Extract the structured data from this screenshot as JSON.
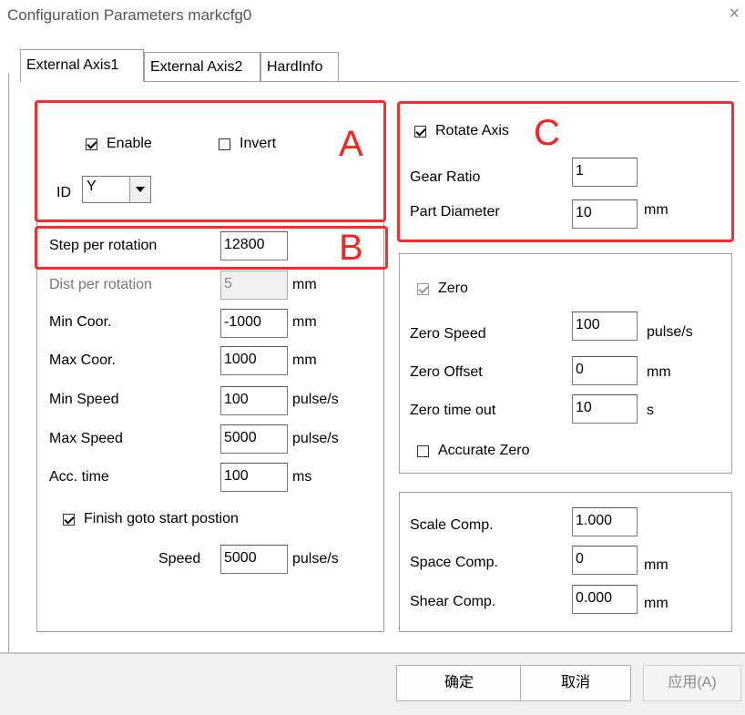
{
  "window": {
    "title": "Configuration Parameters markcfg0",
    "close_glyph": "×"
  },
  "tabs": [
    "External Axis1",
    "External Axis2",
    "HardInfo"
  ],
  "group_a": {
    "enable_label": "Enable",
    "enable_checked": true,
    "invert_label": "Invert",
    "invert_checked": false,
    "id_label": "ID",
    "id_value": "Y",
    "marker": "A"
  },
  "axis_params": {
    "step_label": "Step per rotation",
    "step_value": "12800",
    "dist_label": "Dist per rotation",
    "dist_value": "5",
    "dist_unit": "mm",
    "min_coor_label": "Min Coor.",
    "min_coor_value": "-1000",
    "min_coor_unit": "mm",
    "max_coor_label": "Max Coor.",
    "max_coor_value": "1000",
    "max_coor_unit": "mm",
    "min_speed_label": "Min Speed",
    "min_speed_value": "100",
    "min_speed_unit": "pulse/s",
    "max_speed_label": "Max Speed",
    "max_speed_value": "5000",
    "max_speed_unit": "pulse/s",
    "acc_label": "Acc. time",
    "acc_value": "100",
    "acc_unit": "ms",
    "finish_label": "Finish goto start postion",
    "finish_checked": true,
    "speed_label": "Speed",
    "speed_value": "5000",
    "speed_unit": "pulse/s",
    "marker": "B"
  },
  "group_c": {
    "rotate_label": "Rotate Axis",
    "rotate_checked": true,
    "gear_label": "Gear Ratio",
    "gear_value": "1",
    "diameter_label": "Part Diameter",
    "diameter_value": "10",
    "diameter_unit": "mm",
    "marker": "C"
  },
  "zero_group": {
    "zero_label": "Zero",
    "zero_checked": true,
    "speed_label": "Zero Speed",
    "speed_value": "100",
    "speed_unit": "pulse/s",
    "offset_label": "Zero Offset",
    "offset_value": "0",
    "offset_unit": "mm",
    "timeout_label": "Zero time out",
    "timeout_value": "10",
    "timeout_unit": "s",
    "accurate_label": "Accurate Zero",
    "accurate_checked": false
  },
  "comp_group": {
    "scale_label": "Scale Comp.",
    "scale_value": "1.000",
    "space_label": "Space Comp.",
    "space_value": "0",
    "space_unit": "mm",
    "shear_label": "Shear Comp.",
    "shear_value": "0.000",
    "shear_unit": "mm"
  },
  "footer": {
    "ok": "确定",
    "cancel": "取消",
    "apply": "应用(A)"
  },
  "colors": {
    "annotation_red": "#ff2a2a",
    "border_gray": "#a0a0a0"
  }
}
